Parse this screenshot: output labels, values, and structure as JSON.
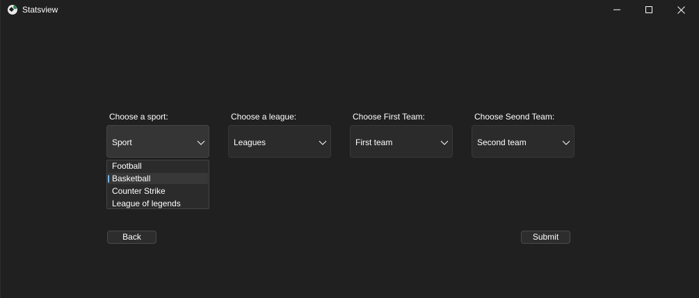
{
  "window": {
    "title": "Statsview"
  },
  "labels": {
    "sport": "Choose a sport:",
    "league": "Choose a league:",
    "first_team": "Choose First Team:",
    "second_team": "Choose Seond Team:"
  },
  "combos": {
    "sport": "Sport",
    "league": "Leagues",
    "first_team": "First team",
    "second_team": "Second team"
  },
  "sport_options": [
    "Football",
    "Basketball",
    "Counter Strike",
    "League of legends"
  ],
  "sport_options_highlighted": "Basketball",
  "buttons": {
    "back": "Back",
    "submit": "Submit"
  },
  "icons": {
    "app": "soccer-ball-icon",
    "minimize": "minimize-icon",
    "maximize": "maximize-icon",
    "close": "close-icon",
    "dropdown": "chevron-down-icon"
  },
  "colors": {
    "background": "#202020",
    "accent": "#76b9ed"
  }
}
